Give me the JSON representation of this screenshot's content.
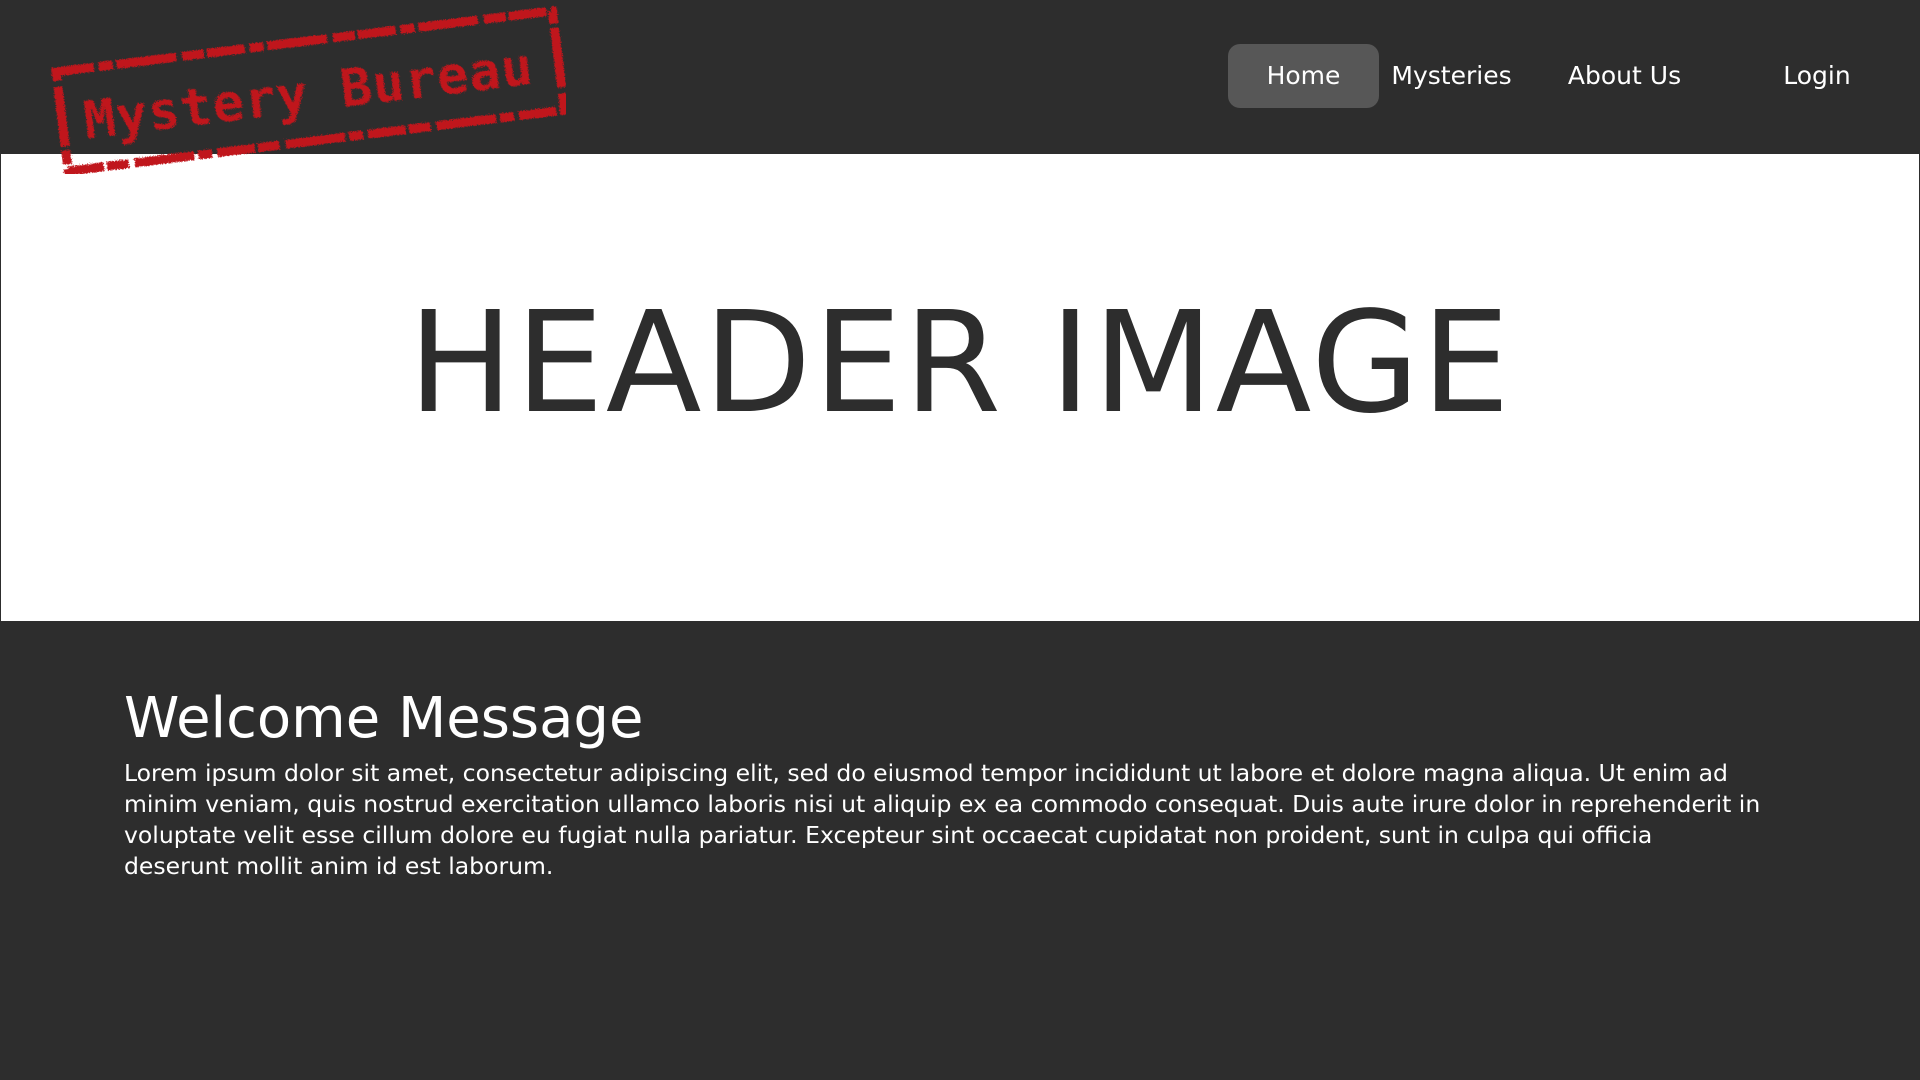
{
  "brand": {
    "logo_text": "Mystery Bureau",
    "logo_color": "#c0161a"
  },
  "nav": {
    "items": [
      {
        "label": "Home",
        "active": true
      },
      {
        "label": "Mysteries",
        "active": false
      },
      {
        "label": "About Us",
        "active": false
      },
      {
        "label": "Login",
        "active": false
      }
    ]
  },
  "hero": {
    "text": "HEADER IMAGE"
  },
  "welcome": {
    "title": "Welcome Message",
    "body": "Lorem ipsum dolor sit amet, consectetur adipiscing elit, sed do eiusmod tempor incididunt ut labore et dolore magna aliqua. Ut enim ad minim veniam, quis nostrud exercitation ullamco laboris nisi ut aliquip ex ea commodo consequat. Duis aute irure dolor in reprehenderit in voluptate velit esse cillum dolore eu fugiat nulla pariatur. Excepteur sint occaecat cupidatat non proident, sunt in culpa qui officia deserunt mollit anim id est laborum."
  },
  "colors": {
    "background": "#2d2d2d",
    "nav_active": "#575757",
    "hero_bg": "#ffffff",
    "text_light": "#ffffff",
    "text_dark": "#2d2d2d"
  }
}
